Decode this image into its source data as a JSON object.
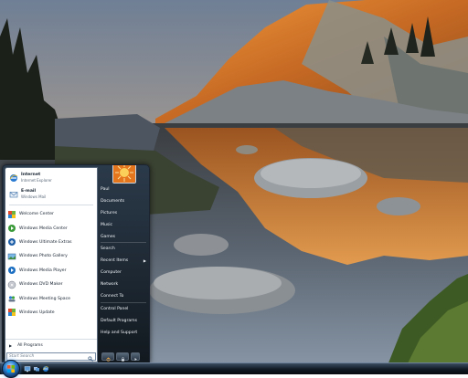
{
  "start_menu": {
    "pinned": [
      {
        "label": "Internet",
        "sub": "Internet Explorer",
        "icon": "internet-explorer-icon"
      },
      {
        "label": "E-mail",
        "sub": "Windows Mail",
        "icon": "windows-mail-icon"
      }
    ],
    "recent": [
      {
        "label": "Welcome Center",
        "icon": "welcome-center-icon"
      },
      {
        "label": "Windows Media Center",
        "icon": "media-center-icon"
      },
      {
        "label": "Windows Ultimate Extras",
        "icon": "ultimate-extras-icon"
      },
      {
        "label": "Windows Photo Gallery",
        "icon": "photo-gallery-icon"
      },
      {
        "label": "Windows Media Player",
        "icon": "media-player-icon"
      },
      {
        "label": "Windows DVD Maker",
        "icon": "dvd-maker-icon"
      },
      {
        "label": "Windows Meeting Space",
        "icon": "meeting-space-icon"
      },
      {
        "label": "Windows Update",
        "icon": "windows-update-icon"
      }
    ],
    "all_programs": "All Programs",
    "search_placeholder": "Start Search",
    "right_items": [
      "Paul",
      "Documents",
      "Pictures",
      "Music",
      "Games",
      "Search",
      "Recent Items",
      "Computer",
      "Network",
      "Connect To",
      "Control Panel",
      "Default Programs",
      "Help and Support"
    ],
    "user_picture_icon": "user-picture-icon"
  },
  "taskbar": {
    "start_button_icon": "windows-logo-icon",
    "quick_launch": [
      "show-desktop-icon",
      "switch-windows-icon",
      "internet-explorer-icon"
    ]
  },
  "colors": {
    "start_menu_dark": "#12191f",
    "taskbar": "#0f1822",
    "orb": "#2b7fd0"
  }
}
